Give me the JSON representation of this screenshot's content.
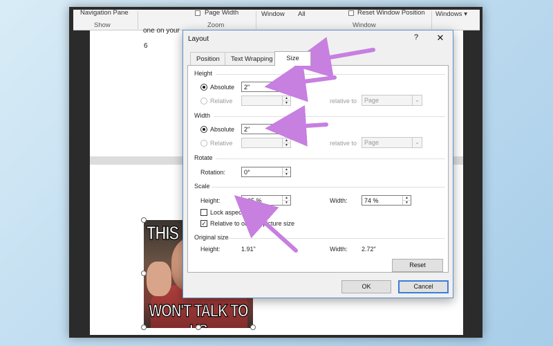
{
  "ribbon": {
    "navigation_pane": "Navigation Pane",
    "show_group": "Show",
    "page_width": "Page Width",
    "zoom_group": "Zoom",
    "window_btn": "Window",
    "all_btn": "All",
    "reset_window_position": "Reset Window Position",
    "windows_btn": "Windows",
    "window_group": "Window"
  },
  "document": {
    "partial_text": "one on your",
    "number": "6",
    "meme_top": "THIS IS",
    "meme_bottom": "WON'T TALK TO US"
  },
  "dialog": {
    "title": "Layout",
    "help": "?",
    "close": "✕",
    "tabs": [
      "Position",
      "Text Wrapping",
      "Size"
    ],
    "active_tab": "Size",
    "height": {
      "section": "Height",
      "absolute_label": "Absolute",
      "absolute_value": "2\"",
      "relative_label": "Relative",
      "relative_value": "",
      "relative_to_label": "relative to",
      "relative_to_value": "Page"
    },
    "width": {
      "section": "Width",
      "absolute_label": "Absolute",
      "absolute_value": "2\"",
      "relative_label": "Relative",
      "relative_value": "",
      "relative_to_label": "relative to",
      "relative_to_value": "Page"
    },
    "rotate": {
      "section": "Rotate",
      "rotation_label": "Rotation:",
      "rotation_value": "0°"
    },
    "scale": {
      "section": "Scale",
      "height_label": "Height:",
      "height_value": "105 %",
      "width_label": "Width:",
      "width_value": "74 %",
      "lock_aspect_label": "Lock aspect ratio",
      "lock_aspect_checked": false,
      "relative_original_label": "Relative to original picture size",
      "relative_original_checked": true
    },
    "original_size": {
      "section": "Original size",
      "height_label": "Height:",
      "height_value": "1.91\"",
      "width_label": "Width:",
      "width_value": "2.72\""
    },
    "reset_button": "Reset",
    "ok_button": "OK",
    "cancel_button": "Cancel"
  },
  "colors": {
    "annotation_arrow": "#c77fe0",
    "dialog_border": "#5b8fc9",
    "default_button_border": "#3b7dd8",
    "desktop_background": "#b9d8ee"
  }
}
